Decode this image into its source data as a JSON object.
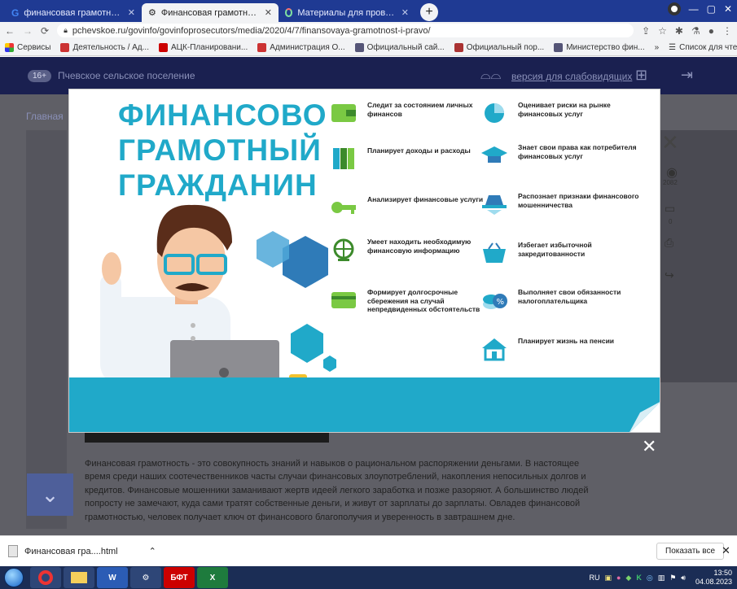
{
  "tabs": [
    {
      "title": "финансовая грамотность – Goo",
      "icon": "google-icon"
    },
    {
      "title": "Финансовая грамотность и пра",
      "icon": "site-icon",
      "active": true
    },
    {
      "title": "Материалы для проведения ур",
      "icon": "loading-icon"
    }
  ],
  "address": {
    "url": "pchevskoe.ru/govinfo/govinfoprosecutors/media/2020/4/7/finansovaya-gramotnost-i-pravo/"
  },
  "bookmarks": [
    {
      "label": "Сервисы",
      "color": "#e33"
    },
    {
      "label": "Деятельность / Ад...",
      "color": "#c33"
    },
    {
      "label": "АЦК-Планировани...",
      "color": "#c00"
    },
    {
      "label": "Администрация О...",
      "color": "#c33"
    },
    {
      "label": "Официальный сай...",
      "color": "#557"
    },
    {
      "label": "Официальный пор...",
      "color": "#a33"
    },
    {
      "label": "Министерство фин...",
      "color": "#557"
    }
  ],
  "bookmarks_more": "»",
  "reading_list": "Список для чтения",
  "site": {
    "age_badge": "16+",
    "name": "Пчевское сельское поселение",
    "vision_link": "версия для слабовидящих",
    "breadcrumb": "Главная",
    "side_count1": "2082",
    "side_count2": "0",
    "body": "Финансовая грамотность - это совокупность знаний и навыков о рациональном распоряжении деньгами. В настоящее время среди наших соотечественников часты случаи финансовых злоупотреблений, накопления непосильных долгов и кредитов. Финансовые мошенники заманивают жертв идеей легкого заработка и позже разоряют. А большинство людей попросту не замечают, куда сами тратят собственные деньги, и живут от зарплаты до зарплаты. Овладев финансовой грамотностью, человек получает ключ от финансового благополучия и уверенность в завтрашнем дне."
  },
  "infographic": {
    "title_lines": [
      "ФИНАНСОВО",
      "ГРАМОТНЫЙ",
      "ГРАЖДАНИН"
    ],
    "features_left": [
      {
        "text": "Следит за состоянием личных финансов",
        "icon": "wallet-icon"
      },
      {
        "text": "Планирует доходы и расходы",
        "icon": "books-icon"
      },
      {
        "text": "Анализирует финансовые услуги",
        "icon": "key-icon"
      },
      {
        "text": "Умеет находить необходимую финансовую информацию",
        "icon": "globe-icon"
      },
      {
        "text": "Формирует долгосрочные сбережения на случай непредвиденных обстоятельств",
        "icon": "card-icon"
      }
    ],
    "features_right": [
      {
        "text": "Оценивает риски на рынке финансовых услуг",
        "icon": "pie-chart-icon"
      },
      {
        "text": "Знает свои права как потребителя финансовых услуг",
        "icon": "graduation-cap-icon"
      },
      {
        "text": "Распознает признаки финансового мошенничества",
        "icon": "spy-icon"
      },
      {
        "text": "Избегает избыточной закредитованности",
        "icon": "basket-icon"
      },
      {
        "text": "Выполняет свои обязанности налогоплательщика",
        "icon": "percent-coins-icon"
      },
      {
        "text": "Планирует жизнь на пенсии",
        "icon": "house-icon"
      }
    ]
  },
  "download": {
    "file": "Финансовая гра....html",
    "show_all": "Показать все"
  },
  "taskbar": {
    "lang": "RU",
    "time": "13:50",
    "date": "04.08.2023"
  },
  "colors": {
    "accent": "#20a9c9",
    "chrome": "#1f3a93",
    "taskbar": "#1b2d55"
  }
}
